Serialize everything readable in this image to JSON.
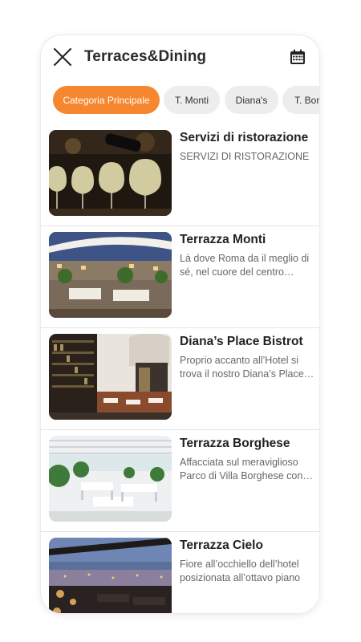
{
  "header": {
    "title": "Terraces&Dining",
    "close_icon": "close-icon",
    "calendar_icon": "calendar-icon"
  },
  "tabs": [
    {
      "label": "Categoria Principale",
      "active": true
    },
    {
      "label": "T. Monti",
      "active": false
    },
    {
      "label": "Diana's",
      "active": false
    },
    {
      "label": "T. Borghese",
      "active": false
    }
  ],
  "items": [
    {
      "title": "Servizi di ristorazione",
      "description": "SERVIZI DI RISTORAZIONE"
    },
    {
      "title": "Terrazza Monti",
      "description": "Là dove Roma da il meglio di sé, nel cuore del centro storico"
    },
    {
      "title": "Diana’s Place Bistrot",
      "description": "Proprio accanto all’Hotel si trova il nostro Diana’s Place Bistrot"
    },
    {
      "title": "Terrazza Borghese",
      "description": "Affacciata sul meraviglioso Parco di Villa Borghese con vista"
    },
    {
      "title": "Terrazza Cielo",
      "description": "Fiore all’occhiello dell’hotel posizionata all’ottavo piano"
    }
  ],
  "colors": {
    "accent": "#f7872e",
    "tab_bg": "#ededed",
    "text": "#222222",
    "muted": "#666666"
  }
}
